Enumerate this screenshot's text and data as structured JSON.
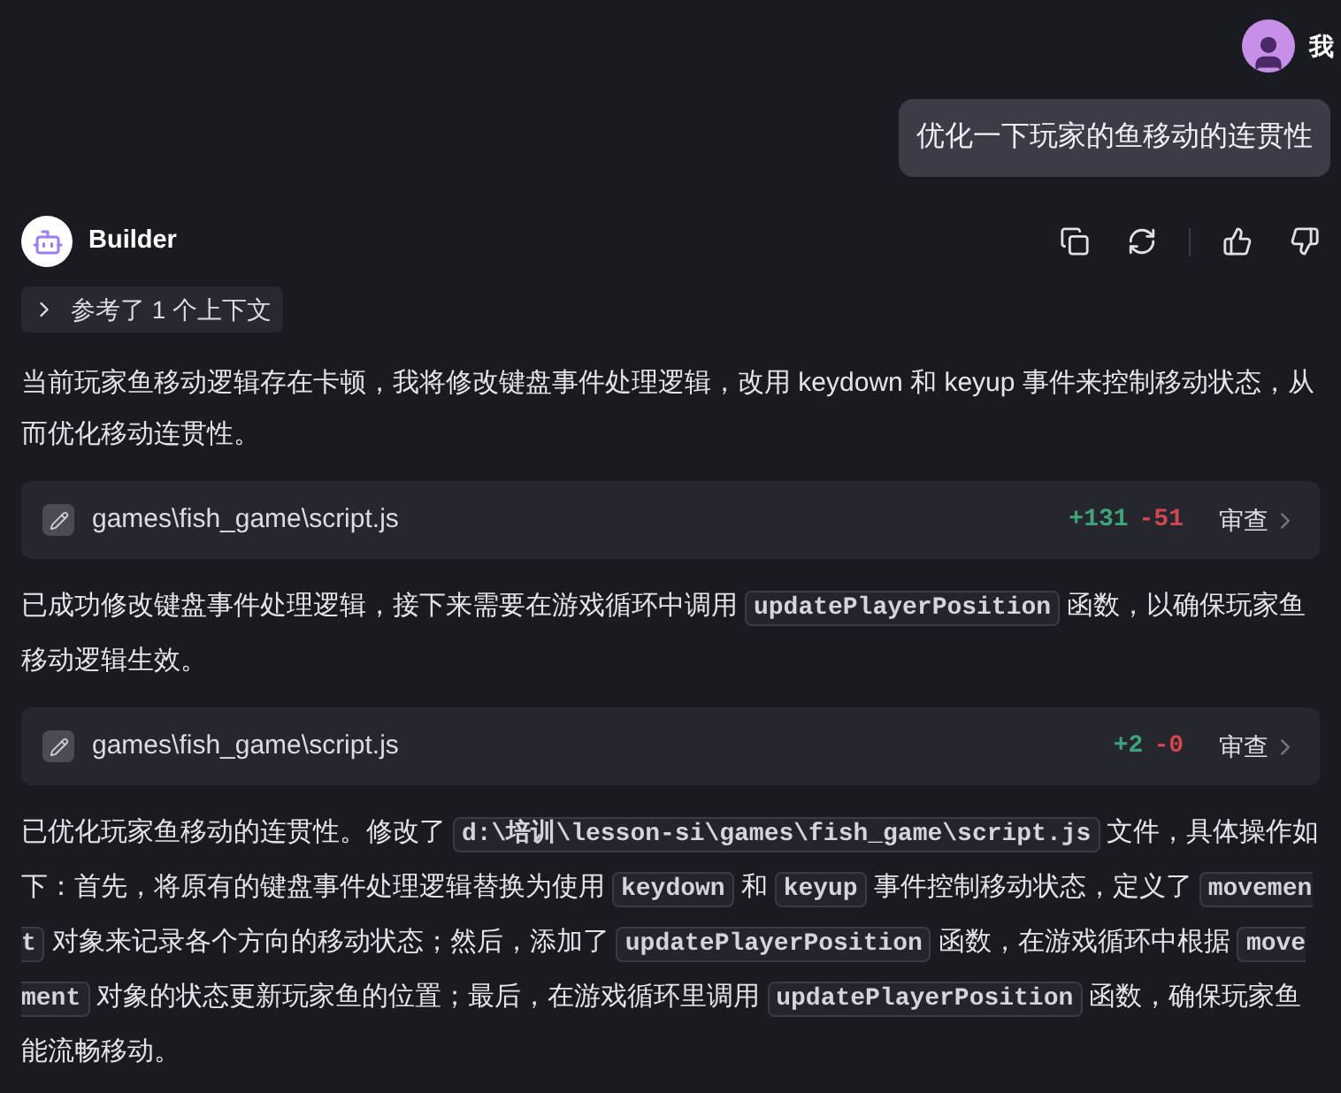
{
  "user": {
    "name": "我",
    "message": "优化一下玩家的鱼移动的连贯性"
  },
  "assistant": {
    "name": "Builder",
    "context_chip": {
      "label": "参考了 1 个上下文",
      "expanded": false
    },
    "blocks": [
      {
        "kind": "paragraph",
        "segments": [
          {
            "kind": "text",
            "text": "当前玩家鱼移动逻辑存在卡顿，我将修改键盘事件处理逻辑，改用 keydown 和 keyup 事件来控制移动状态，从而优化移动连贯性。"
          }
        ]
      },
      {
        "kind": "file",
        "path": "games\\fish_game\\script.js",
        "added": "+131",
        "removed": "-51",
        "action": "审查"
      },
      {
        "kind": "paragraph",
        "segments": [
          {
            "kind": "text",
            "text": "已成功修改键盘事件处理逻辑，接下来需要在游戏循环中调用"
          },
          {
            "kind": "code",
            "text": "updatePlayerPosition"
          },
          {
            "kind": "text",
            "text": "函数，以确保玩家鱼移动逻辑生效。"
          }
        ]
      },
      {
        "kind": "file",
        "path": "games\\fish_game\\script.js",
        "added": "+2",
        "removed": "-0",
        "action": "审查"
      },
      {
        "kind": "paragraph",
        "segments": [
          {
            "kind": "text",
            "text": "已优化玩家鱼移动的连贯性。修改了"
          },
          {
            "kind": "code",
            "text": "d:\\培训\\lesson-si\\games\\fish_game\\script.js"
          },
          {
            "kind": "text",
            "text": "文件，具体操作如下：首先，将原有的键盘事件处理逻辑替换为使用"
          },
          {
            "kind": "code",
            "text": "keydown"
          },
          {
            "kind": "text",
            "text": "和"
          },
          {
            "kind": "code",
            "text": "keyup"
          },
          {
            "kind": "text",
            "text": "事件控制移动状态，定义了"
          },
          {
            "kind": "code",
            "text": "movement"
          },
          {
            "kind": "text",
            "text": "对象来记录各个方向的移动状态；然后，添加了"
          },
          {
            "kind": "code",
            "text": "updatePlayerPosition"
          },
          {
            "kind": "text",
            "text": "函数，在游戏循环中根据"
          },
          {
            "kind": "code",
            "text": "movement"
          },
          {
            "kind": "text",
            "text": "对象的状态更新玩家鱼的位置；最后，在游戏循环里调用"
          },
          {
            "kind": "code",
            "text": "updatePlayerPosition"
          },
          {
            "kind": "text",
            "text": "函数，确保玩家鱼能流畅移动。"
          }
        ]
      }
    ]
  }
}
